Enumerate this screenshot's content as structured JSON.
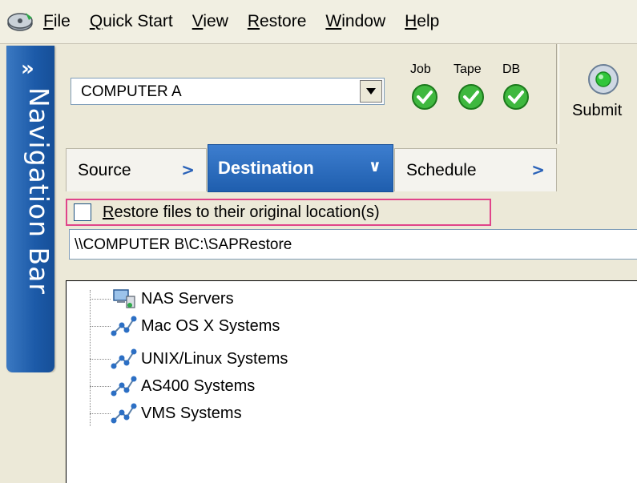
{
  "menu": {
    "items": [
      {
        "label": "File",
        "accel": "F",
        "rest": "ile"
      },
      {
        "label": "Quick Start",
        "accel": "Q",
        "rest": "uick Start"
      },
      {
        "label": "View",
        "accel": "V",
        "rest": "iew"
      },
      {
        "label": "Restore",
        "accel": "R",
        "rest": "estore"
      },
      {
        "label": "Window",
        "accel": "W",
        "rest": "indow"
      },
      {
        "label": "Help",
        "accel": "H",
        "rest": "elp"
      }
    ]
  },
  "nav_bar": {
    "chevron": "»",
    "label": "Navigation Bar",
    "color": "#1c5aa8"
  },
  "server_select": {
    "value": "COMPUTER A"
  },
  "status": {
    "job": {
      "label": "Job",
      "state": "ok"
    },
    "tape": {
      "label": "Tape",
      "state": "ok"
    },
    "db": {
      "label": "DB",
      "state": "ok"
    },
    "ok_color": "#3fb83f"
  },
  "submit": {
    "label": "Submit"
  },
  "tabs": [
    {
      "label": "Source",
      "active": false
    },
    {
      "label": "Destination",
      "active": true
    },
    {
      "label": "Schedule",
      "active": false
    }
  ],
  "restore_option": {
    "accel": "R",
    "rest": "estore files to their original location(s)",
    "checked": false,
    "highlight_color": "#e0448a"
  },
  "destination_path": {
    "value": "\\\\COMPUTER B\\C:\\SAPRestore"
  },
  "tree": {
    "items": [
      {
        "label": "NAS Servers",
        "icon": "nas-server-icon"
      },
      {
        "label": "Mac OS X Systems",
        "icon": "network-node-icon"
      },
      {
        "label": "UNIX/Linux Systems",
        "icon": "network-node-icon"
      },
      {
        "label": "AS400 Systems",
        "icon": "network-node-icon"
      },
      {
        "label": "VMS Systems",
        "icon": "network-node-icon"
      }
    ]
  }
}
